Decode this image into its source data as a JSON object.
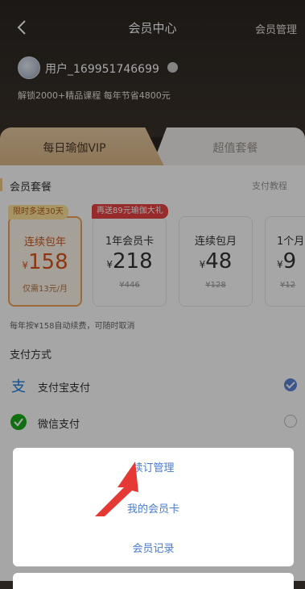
{
  "header": {
    "title": "会员中心",
    "manage": "会员管理",
    "username": "用户_169951746699",
    "description": "解锁2000+精品课程  每年节省4800元"
  },
  "tabs": {
    "vip": "每日瑜伽VIP",
    "super": "超值套餐"
  },
  "packages": {
    "title": "会员套餐",
    "guide": "支付教程",
    "plans": [
      {
        "badge": "限时多送30天",
        "name": "连续包年",
        "currency": "¥",
        "price": "158",
        "sub": "仅需13元/月"
      },
      {
        "badge": "再送89元瑜伽大礼",
        "name": "1年会员卡",
        "currency": "¥",
        "price": "218",
        "sub": "¥446"
      },
      {
        "name": "连续包月",
        "currency": "¥",
        "price": "48",
        "sub": "¥128"
      },
      {
        "name": "1个月",
        "currency": "¥",
        "price": "9",
        "sub": "¥12"
      }
    ],
    "note": "每年按¥158自动续费，可随时取消"
  },
  "payment": {
    "title": "支付方式",
    "alipay": "支付宝支付",
    "wechat": "微信支付"
  },
  "popup": {
    "items": [
      "续订管理",
      "我的会员卡",
      "会员记录"
    ]
  },
  "colors": {
    "accent": "#f0a45a",
    "link_blue": "#4a7bd0",
    "badge_red": "#e84343",
    "header_dark": "#2b2622",
    "arrow_red": "#e53935"
  }
}
